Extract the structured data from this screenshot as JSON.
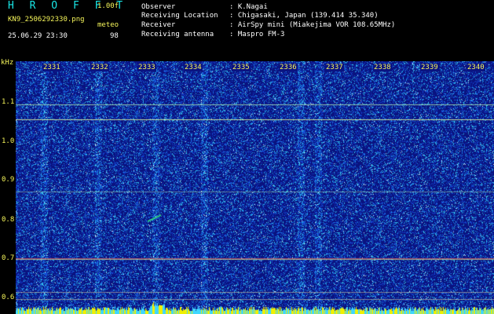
{
  "app": {
    "title": "H R O F F T",
    "version": "1.00f",
    "filename": "KN9_2506292330.png",
    "meteo_label": "meteo",
    "datetime": "25.06.29 23:30",
    "count": "98"
  },
  "info": [
    {
      "key": "Observer",
      "value": ": K.Nagai"
    },
    {
      "key": "Receiving Location",
      "value": ": Chigasaki, Japan (139.414 35.340)"
    },
    {
      "key": "Receiver",
      "value": ": AirSpy mini (Miakejima VOR 108.65MHz)"
    },
    {
      "key": "Receiving antenna",
      "value": ": Maspro FM-3"
    }
  ],
  "axis": {
    "y_unit": "kHz",
    "y_ticks": [
      "1.1",
      "1.0",
      "0.9",
      "0.8",
      "0.7",
      "0.6"
    ],
    "minute_labels": [
      "2331",
      "2332",
      "2333",
      "2334",
      "2335",
      "2336",
      "2337",
      "2338",
      "2339",
      "2340"
    ]
  },
  "colors": {
    "background": "#0a1380",
    "text_cyan": "#19e6e6",
    "text_yellow": "#f5f55a",
    "carrier_line": "#9ad6b0",
    "meteor_trace": "#30e080",
    "bottom_band": "#f0f000"
  }
}
